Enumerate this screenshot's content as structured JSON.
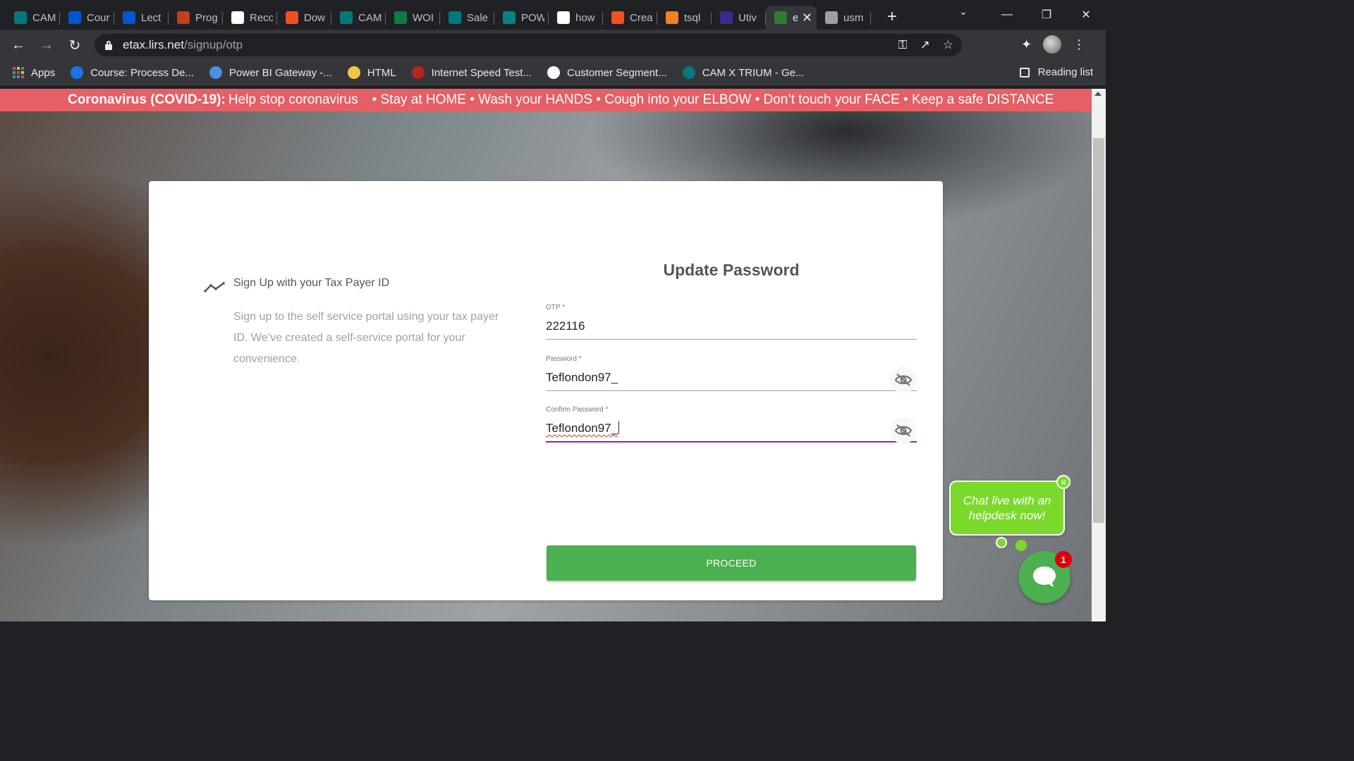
{
  "browser": {
    "tabs": [
      {
        "title": "CAM",
        "icon": "sharepoint-icon",
        "color": "#03787c"
      },
      {
        "title": "Cour",
        "icon": "coursera-icon",
        "color": "#0056d2"
      },
      {
        "title": "Lect",
        "icon": "coursera-icon",
        "color": "#0056d2"
      },
      {
        "title": "Prog",
        "icon": "powerpoint-icon",
        "color": "#c43e1c"
      },
      {
        "title": "Reco",
        "icon": "microphone-icon",
        "color": "#ffffff"
      },
      {
        "title": "Dow",
        "icon": "microsoft-icon",
        "color": "#f25022"
      },
      {
        "title": "CAM",
        "icon": "sharepoint-icon",
        "color": "#03787c"
      },
      {
        "title": "WOI",
        "icon": "excel-icon",
        "color": "#107c41"
      },
      {
        "title": "Sale",
        "icon": "sharepoint-icon",
        "color": "#03787c"
      },
      {
        "title": "POW",
        "icon": "forms-icon",
        "color": "#038387"
      },
      {
        "title": "how",
        "icon": "google-icon",
        "color": "#ffffff"
      },
      {
        "title": "Crea",
        "icon": "microsoft-icon",
        "color": "#f25022"
      },
      {
        "title": "tsql",
        "icon": "stackoverflow-icon",
        "color": "#f48024"
      },
      {
        "title": "Utiv",
        "icon": "utiva-icon",
        "color": "#3b2a8f"
      },
      {
        "title": "e",
        "icon": "lirs-icon",
        "color": "#2e7d32",
        "active": true
      },
      {
        "title": "usm",
        "icon": "globe-icon",
        "color": "#9aa0a6"
      }
    ],
    "new_tab_label": "+",
    "url_host": "etax.lirs.net",
    "url_path": "/signup/otp",
    "bookmarks": [
      {
        "label": "Apps",
        "icon": "apps-grid-icon"
      },
      {
        "label": "Course: Process De...",
        "icon": "pluralsight-icon",
        "color": "#1a73e8"
      },
      {
        "label": "Power BI Gateway -...",
        "icon": "powerbi-gateway-icon",
        "color": "#4a90e2"
      },
      {
        "label": "HTML",
        "icon": "folder-icon",
        "color": "#f4c542"
      },
      {
        "label": "Internet Speed Test...",
        "icon": "speedometer-icon",
        "color": "#b3261e"
      },
      {
        "label": "Customer Segment...",
        "icon": "github-icon",
        "color": "#ffffff"
      },
      {
        "label": "CAM X TRIUM - Ge...",
        "icon": "sharepoint-icon",
        "color": "#03787c"
      }
    ],
    "reading_list_label": "Reading list"
  },
  "banner": {
    "strong": "Coronavirus (COVID-19):",
    "rest": "Help stop coronavirus",
    "tips": "• Stay at HOME • Wash your HANDS • Cough into your ELBOW • Don’t touch your FACE • Keep a safe DISTANCE",
    "color": "#e55f66"
  },
  "left": {
    "title": "Sign Up with your Tax Payer ID",
    "description": "Sign up to the self service portal using your tax payer ID. We’ve created a self-service portal for your convenience."
  },
  "form": {
    "title": "Update Password",
    "otp_label": "OTP *",
    "otp_value": "222116",
    "password_label": "Password *",
    "password_value": "Teflondon97_",
    "confirm_label": "Confirm Password *",
    "confirm_value": "Teflondon97_",
    "proceed_label": "PROCEED",
    "accent_color": "#8e24aa",
    "button_color": "#4caf50"
  },
  "chat": {
    "prompt": "Chat live with an helpdesk now!",
    "close_label": "×",
    "badge_count": "1",
    "color": "#7bd92b"
  }
}
